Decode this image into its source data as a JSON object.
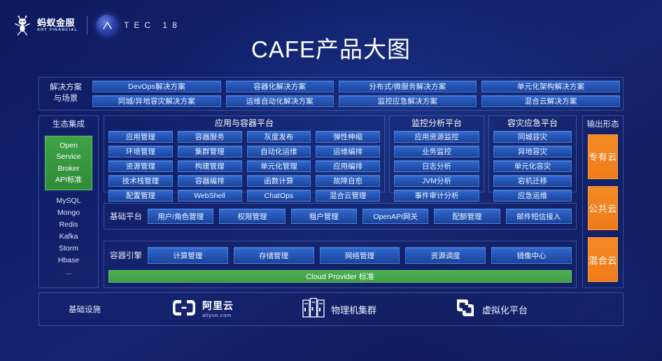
{
  "header": {
    "ant_cn": "蚂蚁金服",
    "ant_en": "ANT FINANCIAL",
    "atec_letters": "TEC 18"
  },
  "title": "CAFE产品大图",
  "solutions": {
    "label": "解决方案\n与场景",
    "label_line1": "解决方案",
    "label_line2": "与场景",
    "row1": [
      "DevOps解决方案",
      "容器化解决方案",
      "分布式/微服务解决方案",
      "单元化架构解决方案"
    ],
    "row2": [
      "同城/异地容灾解决方案",
      "运维自动化解决方案",
      "监控应急解决方案",
      "混合云解决方案"
    ]
  },
  "ecosystem": {
    "title": "生态集成",
    "standard": [
      "Open",
      "Service",
      "Broker",
      "API标准"
    ],
    "items": [
      "MySQL",
      "Mongo",
      "Redis",
      "Kafka",
      "Storm",
      "Hbase",
      "..."
    ],
    "accent": "#3fa346"
  },
  "app_container_platform": {
    "title": "应用与容器平台",
    "cells": [
      "应用管理",
      "容器服务",
      "灰度发布",
      "弹性伸缩",
      "环境管理",
      "集群管理",
      "自动化运维",
      "运维编排",
      "资源管理",
      "构建管理",
      "单元化管理",
      "应用编排",
      "技术栈管理",
      "容器编排",
      "函数计算",
      "故障自愈",
      "配置管理",
      "WebShell",
      "ChatOps",
      "混合云管理"
    ]
  },
  "monitor_platform": {
    "title": "监控分析平台",
    "cells": [
      "应用资源监控",
      "业务监控",
      "日志分析",
      "JVM分析",
      "事件审计分析"
    ]
  },
  "dr_platform": {
    "title": "容灾应急平台",
    "cells": [
      "同城容灾",
      "异地容灾",
      "单元化容灾",
      "宕机迁移",
      "应急运维"
    ]
  },
  "output_forms": {
    "title": "输出形态",
    "items": [
      "专有云",
      "公共云",
      "混合云"
    ],
    "accent": "#ef7c1a"
  },
  "base_platform": {
    "label": "基础平台",
    "cells": [
      "用户/角色管理",
      "权限管理",
      "租户管理",
      "OpenAPI网关",
      "配额管理",
      "邮件短信接入"
    ]
  },
  "container_engine": {
    "label": "容器引擎",
    "cells": [
      "计算管理",
      "存储管理",
      "网络管理",
      "资源调度",
      "镜像中心"
    ],
    "cloud_provider_bar": "Cloud Provider 标准"
  },
  "infrastructure": {
    "label": "基础设施",
    "aliyun_cn": "阿里云",
    "aliyun_en": "aliyun.com",
    "physical": "物理机集群",
    "virtual": "虚拟化平台"
  },
  "colors": {
    "background": "#101f6b",
    "cell_blue": "#2556b6",
    "green": "#3d9c44",
    "orange": "#ef7c1a"
  }
}
